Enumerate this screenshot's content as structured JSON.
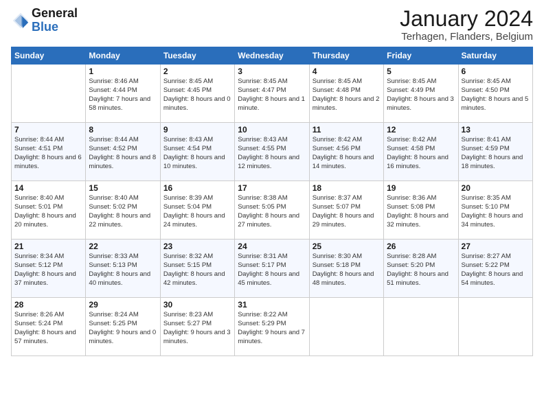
{
  "logo": {
    "text_general": "General",
    "text_blue": "Blue"
  },
  "title": "January 2024",
  "location": "Terhagen, Flanders, Belgium",
  "days_of_week": [
    "Sunday",
    "Monday",
    "Tuesday",
    "Wednesday",
    "Thursday",
    "Friday",
    "Saturday"
  ],
  "weeks": [
    [
      {
        "day": "",
        "sunrise": "",
        "sunset": "",
        "daylight": ""
      },
      {
        "day": "1",
        "sunrise": "Sunrise: 8:46 AM",
        "sunset": "Sunset: 4:44 PM",
        "daylight": "Daylight: 7 hours and 58 minutes."
      },
      {
        "day": "2",
        "sunrise": "Sunrise: 8:45 AM",
        "sunset": "Sunset: 4:45 PM",
        "daylight": "Daylight: 8 hours and 0 minutes."
      },
      {
        "day": "3",
        "sunrise": "Sunrise: 8:45 AM",
        "sunset": "Sunset: 4:47 PM",
        "daylight": "Daylight: 8 hours and 1 minute."
      },
      {
        "day": "4",
        "sunrise": "Sunrise: 8:45 AM",
        "sunset": "Sunset: 4:48 PM",
        "daylight": "Daylight: 8 hours and 2 minutes."
      },
      {
        "day": "5",
        "sunrise": "Sunrise: 8:45 AM",
        "sunset": "Sunset: 4:49 PM",
        "daylight": "Daylight: 8 hours and 3 minutes."
      },
      {
        "day": "6",
        "sunrise": "Sunrise: 8:45 AM",
        "sunset": "Sunset: 4:50 PM",
        "daylight": "Daylight: 8 hours and 5 minutes."
      }
    ],
    [
      {
        "day": "7",
        "sunrise": "Sunrise: 8:44 AM",
        "sunset": "Sunset: 4:51 PM",
        "daylight": "Daylight: 8 hours and 6 minutes."
      },
      {
        "day": "8",
        "sunrise": "Sunrise: 8:44 AM",
        "sunset": "Sunset: 4:52 PM",
        "daylight": "Daylight: 8 hours and 8 minutes."
      },
      {
        "day": "9",
        "sunrise": "Sunrise: 8:43 AM",
        "sunset": "Sunset: 4:54 PM",
        "daylight": "Daylight: 8 hours and 10 minutes."
      },
      {
        "day": "10",
        "sunrise": "Sunrise: 8:43 AM",
        "sunset": "Sunset: 4:55 PM",
        "daylight": "Daylight: 8 hours and 12 minutes."
      },
      {
        "day": "11",
        "sunrise": "Sunrise: 8:42 AM",
        "sunset": "Sunset: 4:56 PM",
        "daylight": "Daylight: 8 hours and 14 minutes."
      },
      {
        "day": "12",
        "sunrise": "Sunrise: 8:42 AM",
        "sunset": "Sunset: 4:58 PM",
        "daylight": "Daylight: 8 hours and 16 minutes."
      },
      {
        "day": "13",
        "sunrise": "Sunrise: 8:41 AM",
        "sunset": "Sunset: 4:59 PM",
        "daylight": "Daylight: 8 hours and 18 minutes."
      }
    ],
    [
      {
        "day": "14",
        "sunrise": "Sunrise: 8:40 AM",
        "sunset": "Sunset: 5:01 PM",
        "daylight": "Daylight: 8 hours and 20 minutes."
      },
      {
        "day": "15",
        "sunrise": "Sunrise: 8:40 AM",
        "sunset": "Sunset: 5:02 PM",
        "daylight": "Daylight: 8 hours and 22 minutes."
      },
      {
        "day": "16",
        "sunrise": "Sunrise: 8:39 AM",
        "sunset": "Sunset: 5:04 PM",
        "daylight": "Daylight: 8 hours and 24 minutes."
      },
      {
        "day": "17",
        "sunrise": "Sunrise: 8:38 AM",
        "sunset": "Sunset: 5:05 PM",
        "daylight": "Daylight: 8 hours and 27 minutes."
      },
      {
        "day": "18",
        "sunrise": "Sunrise: 8:37 AM",
        "sunset": "Sunset: 5:07 PM",
        "daylight": "Daylight: 8 hours and 29 minutes."
      },
      {
        "day": "19",
        "sunrise": "Sunrise: 8:36 AM",
        "sunset": "Sunset: 5:08 PM",
        "daylight": "Daylight: 8 hours and 32 minutes."
      },
      {
        "day": "20",
        "sunrise": "Sunrise: 8:35 AM",
        "sunset": "Sunset: 5:10 PM",
        "daylight": "Daylight: 8 hours and 34 minutes."
      }
    ],
    [
      {
        "day": "21",
        "sunrise": "Sunrise: 8:34 AM",
        "sunset": "Sunset: 5:12 PM",
        "daylight": "Daylight: 8 hours and 37 minutes."
      },
      {
        "day": "22",
        "sunrise": "Sunrise: 8:33 AM",
        "sunset": "Sunset: 5:13 PM",
        "daylight": "Daylight: 8 hours and 40 minutes."
      },
      {
        "day": "23",
        "sunrise": "Sunrise: 8:32 AM",
        "sunset": "Sunset: 5:15 PM",
        "daylight": "Daylight: 8 hours and 42 minutes."
      },
      {
        "day": "24",
        "sunrise": "Sunrise: 8:31 AM",
        "sunset": "Sunset: 5:17 PM",
        "daylight": "Daylight: 8 hours and 45 minutes."
      },
      {
        "day": "25",
        "sunrise": "Sunrise: 8:30 AM",
        "sunset": "Sunset: 5:18 PM",
        "daylight": "Daylight: 8 hours and 48 minutes."
      },
      {
        "day": "26",
        "sunrise": "Sunrise: 8:28 AM",
        "sunset": "Sunset: 5:20 PM",
        "daylight": "Daylight: 8 hours and 51 minutes."
      },
      {
        "day": "27",
        "sunrise": "Sunrise: 8:27 AM",
        "sunset": "Sunset: 5:22 PM",
        "daylight": "Daylight: 8 hours and 54 minutes."
      }
    ],
    [
      {
        "day": "28",
        "sunrise": "Sunrise: 8:26 AM",
        "sunset": "Sunset: 5:24 PM",
        "daylight": "Daylight: 8 hours and 57 minutes."
      },
      {
        "day": "29",
        "sunrise": "Sunrise: 8:24 AM",
        "sunset": "Sunset: 5:25 PM",
        "daylight": "Daylight: 9 hours and 0 minutes."
      },
      {
        "day": "30",
        "sunrise": "Sunrise: 8:23 AM",
        "sunset": "Sunset: 5:27 PM",
        "daylight": "Daylight: 9 hours and 3 minutes."
      },
      {
        "day": "31",
        "sunrise": "Sunrise: 8:22 AM",
        "sunset": "Sunset: 5:29 PM",
        "daylight": "Daylight: 9 hours and 7 minutes."
      },
      {
        "day": "",
        "sunrise": "",
        "sunset": "",
        "daylight": ""
      },
      {
        "day": "",
        "sunrise": "",
        "sunset": "",
        "daylight": ""
      },
      {
        "day": "",
        "sunrise": "",
        "sunset": "",
        "daylight": ""
      }
    ]
  ]
}
